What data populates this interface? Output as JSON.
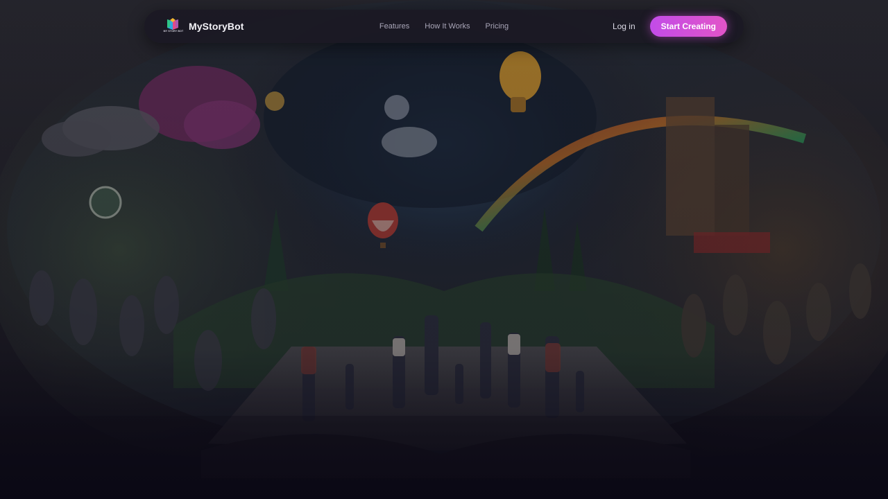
{
  "brand": {
    "name": "MyStoryBot",
    "logo_caption": "MY STORY BOT",
    "logo_icon": "open-book-logo-icon"
  },
  "nav": {
    "links": [
      {
        "label": "Features"
      },
      {
        "label": "How It Works"
      },
      {
        "label": "Pricing"
      }
    ],
    "login_label": "Log in",
    "cta_label": "Start Creating"
  },
  "colors": {
    "accent_start": "#c24ce8",
    "accent_end": "#e254c8",
    "nav_bg": "#1b1924",
    "page_bg": "#15141c"
  },
  "hero": {
    "image_subject": "hero-storybook-illustration"
  }
}
